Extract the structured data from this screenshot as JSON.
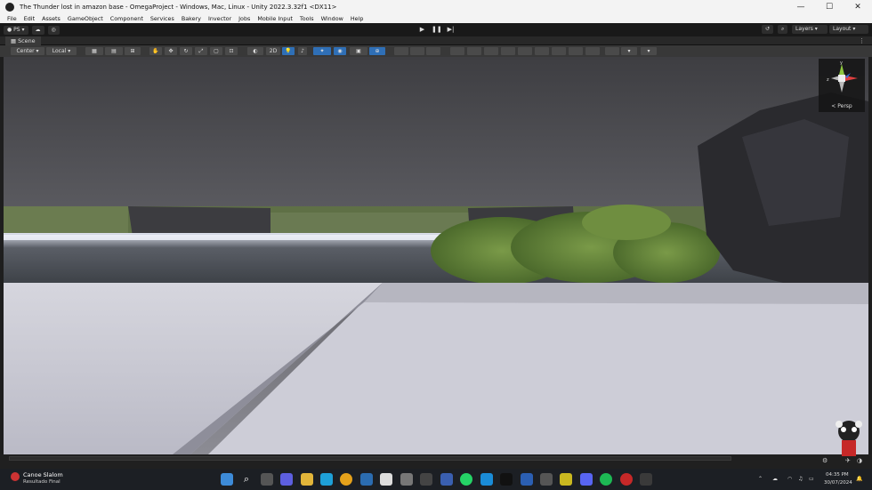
{
  "window": {
    "title": "The Thunder lost in amazon base - OmegaProject - Windows, Mac, Linux - Unity 2022.3.32f1 <DX11>",
    "controls": [
      "—",
      "☐",
      "✕"
    ]
  },
  "menu": [
    "File",
    "Edit",
    "Assets",
    "GameObject",
    "Component",
    "Services",
    "Bakery",
    "Invector",
    "Jobs",
    "Mobile Input",
    "Tools",
    "Window",
    "Help"
  ],
  "toolbar": {
    "account": "PS",
    "layers_label": "Layers",
    "layout_label": "Layout"
  },
  "scene": {
    "tab_label": "Scene",
    "pivot": "Center",
    "space": "Local",
    "mode_2d": "2D",
    "projection": "Persp"
  },
  "taskbar": {
    "notification_title": "Canoe Slalom",
    "notification_sub": "Resultado Final",
    "time": "04:35 PM",
    "date": "30/07/2024"
  },
  "colors": {
    "accent": "#2f6fb6",
    "sky": "#5a5a60",
    "floor": "#c8c8d2"
  }
}
